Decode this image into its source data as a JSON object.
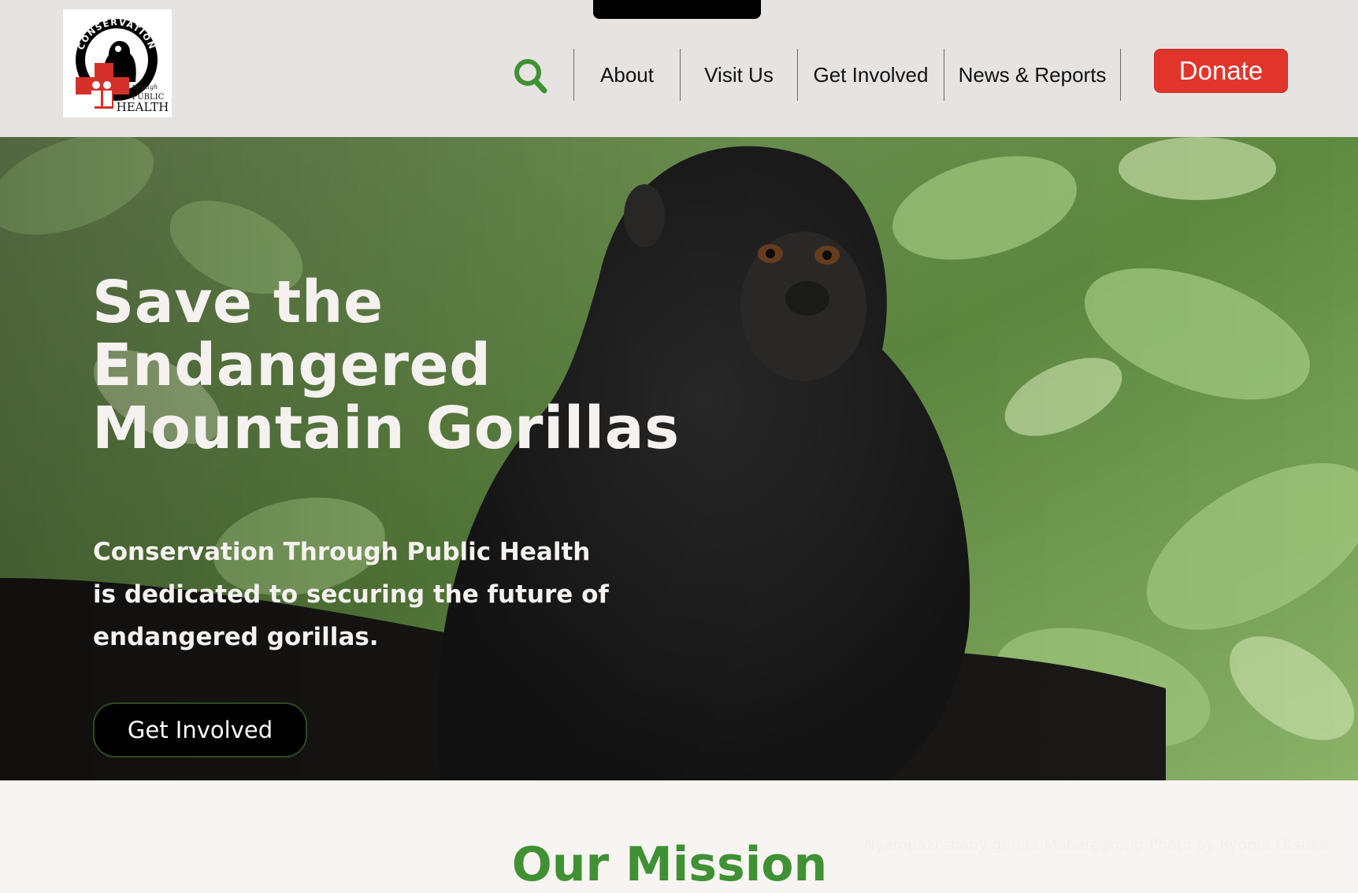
{
  "brand": {
    "logo_text_top": "CONSERVATION",
    "logo_text_through": "through",
    "logo_text_public": "PUBLIC",
    "logo_text_health": "HEALTH"
  },
  "header": {
    "search_icon": "search-icon",
    "nav": [
      {
        "label": "About"
      },
      {
        "label": "Visit Us"
      },
      {
        "label": "Get Involved"
      },
      {
        "label": "News & Reports"
      }
    ],
    "donate_label": "Donate"
  },
  "hero": {
    "title_lines": [
      "Save the",
      "Endangered",
      "Mountain Gorillas"
    ],
    "description": "Conservation Through Public Health is dedicated to securing the future of endangered gorillas.",
    "cta_label": "Get Involved",
    "photo_credit": "Nyampazi'sbaby gorilla-Mubaregroup-Photo by Ryoma Otsuka"
  },
  "mission": {
    "title": "Our Mission"
  },
  "colors": {
    "header_bg": "#e6e3e1",
    "donate_red": "#e1352c",
    "accent_green": "#3f9134",
    "page_bg": "#f7f4f2"
  }
}
